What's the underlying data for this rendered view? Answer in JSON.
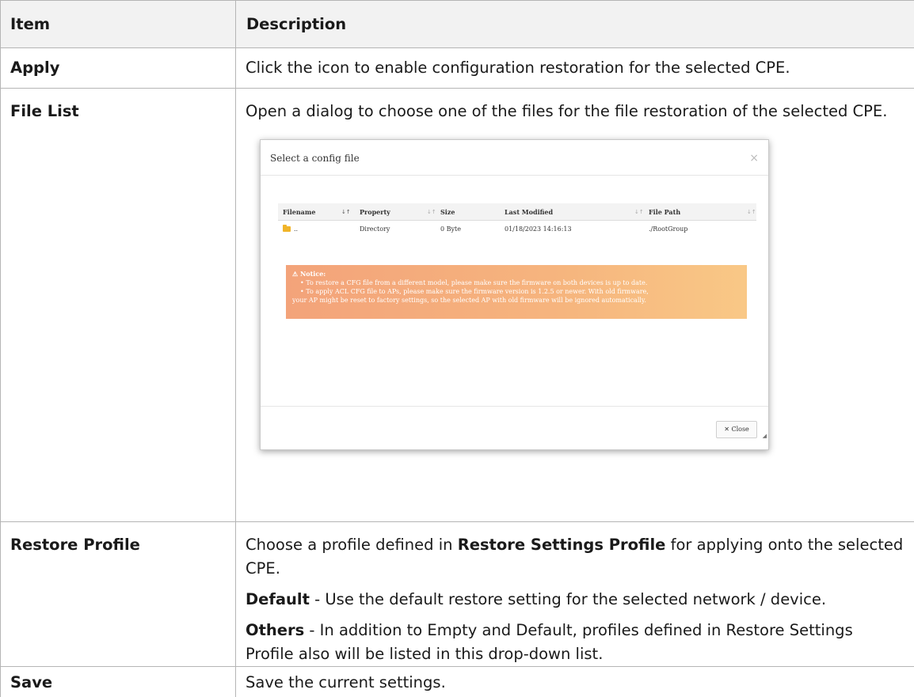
{
  "table": {
    "header": {
      "item": "Item",
      "description": "Description"
    },
    "rows": {
      "apply": {
        "item": "Apply",
        "desc": "Click the icon to enable configuration restoration for the selected CPE."
      },
      "file_list": {
        "item": "File List",
        "desc": "Open a dialog to choose one of the files for the file restoration of the selected CPE."
      },
      "restore_profile": {
        "item": "Restore Profile",
        "desc_prefix": "Choose a profile defined in ",
        "desc_bold": "Restore Settings Profile",
        "desc_suffix": " for applying onto the selected CPE.",
        "default_label": "Default",
        "default_text": " - Use the default restore setting for the selected network / device.",
        "others_label": "Others",
        "others_text": " - In addition to Empty and Default, profiles defined in Restore Settings Profile also will be listed in this drop-down list."
      },
      "save": {
        "item": "Save",
        "desc": "Save the current settings."
      }
    }
  },
  "dialog": {
    "title": "Select a config file",
    "close_x": "×",
    "columns": {
      "filename": "Filename",
      "property": "Property",
      "size": "Size",
      "last_modified": "Last Modified",
      "file_path": "File Path"
    },
    "sort_active": "↓↑",
    "sort_idle": "↓↑",
    "row": {
      "filename": "..",
      "property": "Directory",
      "size": "0 Byte",
      "last_modified": "01/18/2023 14:16:13",
      "file_path": "./RootGroup"
    },
    "notice": {
      "title": "⚠ Notice:",
      "line1": "To restore a CFG file from a different model, please make sure the firmware on both devices is up to date.",
      "line2": "To apply ACL CFG file to APs, please make sure the firmware version is 1.2.5 or newer. With old firmware,",
      "line3": "your AP might be reset to factory settings, so the selected AP with old firmware will be ignored automatically."
    },
    "close_icon": "✕",
    "close_label": "Close",
    "resize_glyph": "◢"
  }
}
